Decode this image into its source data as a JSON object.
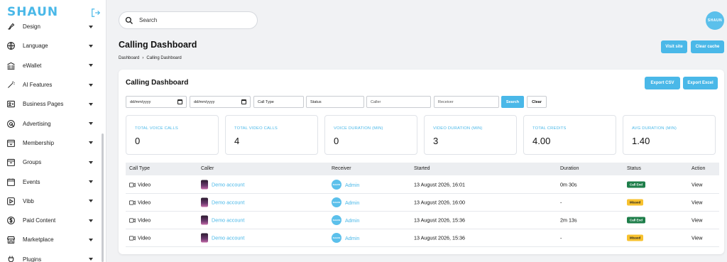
{
  "app": {
    "logo": "SHAUN",
    "avatar_text": "SHAUN"
  },
  "colors": {
    "accent": "#4ab8e8",
    "call_end": "#1e7e4a",
    "missed": "#f7c12e"
  },
  "sidebar": {
    "items": [
      {
        "label": "Design",
        "icon": "paint-icon"
      },
      {
        "label": "Language",
        "icon": "globe-icon"
      },
      {
        "label": "eWallet",
        "icon": "bank-icon"
      },
      {
        "label": "AI Features",
        "icon": "magic-wand-icon"
      },
      {
        "label": "Business Pages",
        "icon": "id-card-icon"
      },
      {
        "label": "Advertising",
        "icon": "target-icon"
      },
      {
        "label": "Membership",
        "icon": "membership-box-icon"
      },
      {
        "label": "Groups",
        "icon": "groups-box-icon"
      },
      {
        "label": "Events",
        "icon": "calendar-icon"
      },
      {
        "label": "Vibb",
        "icon": "play-square-icon"
      },
      {
        "label": "Paid Content",
        "icon": "dollar-circle-icon"
      },
      {
        "label": "Marketplace",
        "icon": "store-icon"
      },
      {
        "label": "Plugins",
        "icon": "plug-icon"
      }
    ]
  },
  "header": {
    "search_placeholder": "Search"
  },
  "page": {
    "title": "Calling Dashboard",
    "breadcrumb": [
      "Dashboard",
      "Calling Dashboard"
    ],
    "visit_site": "Visit site",
    "clear_cache": "Clear cache"
  },
  "card": {
    "title": "Calling Dashboard",
    "export_csv": "Export CSV",
    "export_excel": "Export Excel"
  },
  "filters": {
    "date_from": "dd/mm/yyyy",
    "date_to": "dd/mm/yyyy",
    "call_type": "Call Type",
    "status": "Status",
    "caller": "Caller",
    "receiver": "Receiver",
    "search_btn": "Search",
    "clear_btn": "Clear"
  },
  "stats": [
    {
      "label": "TOTAL VOICE CALLS",
      "value": "0"
    },
    {
      "label": "TOTAL VIDEO CALLS",
      "value": "4"
    },
    {
      "label": "VOICE DURATION (MIN)",
      "value": "0"
    },
    {
      "label": "VIDEO DURATION (MIN)",
      "value": "3"
    },
    {
      "label": "TOTAL CREDITS",
      "value": "4.00"
    },
    {
      "label": "AVG DURATION (MIN)",
      "value": "1.40"
    }
  ],
  "table": {
    "columns": [
      "Call Type",
      "Caller",
      "Receiver",
      "Started",
      "Duration",
      "Status",
      "Action"
    ],
    "rows": [
      {
        "type": "Video",
        "caller": "Demo account",
        "receiver": "Admin",
        "started": "13 August 2026, 16:01",
        "duration": "0m 30s",
        "status": "Call End",
        "action": "View"
      },
      {
        "type": "Video",
        "caller": "Demo account",
        "receiver": "Admin",
        "started": "13 August 2026, 16:00",
        "duration": "-",
        "status": "Missed",
        "action": "View"
      },
      {
        "type": "Video",
        "caller": "Demo account",
        "receiver": "Admin",
        "started": "13 August 2026, 15:36",
        "duration": "2m 13s",
        "status": "Call End",
        "action": "View"
      },
      {
        "type": "Video",
        "caller": "Demo account",
        "receiver": "Admin",
        "started": "13 August 2026, 15:36",
        "duration": "-",
        "status": "Missed",
        "action": "View"
      }
    ]
  }
}
